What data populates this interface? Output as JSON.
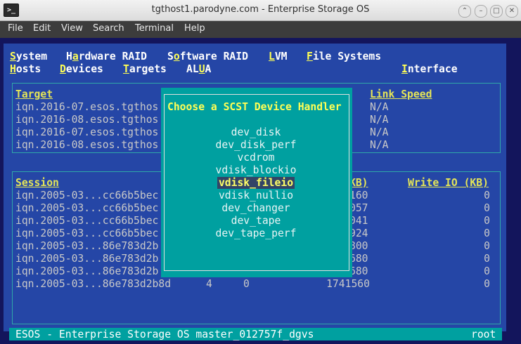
{
  "window": {
    "title": "tgthost1.parodyne.com - Enterprise Storage OS",
    "app_icon": ">_"
  },
  "menubar": {
    "items": [
      "File",
      "Edit",
      "View",
      "Search",
      "Terminal",
      "Help"
    ]
  },
  "tui_menu": {
    "row1": [
      {
        "hotkey": "S",
        "rest": "ystem"
      },
      {
        "pre": "H",
        "hotkey": "a",
        "rest": "rdware RAID"
      },
      {
        "pre": "S",
        "hotkey": "o",
        "rest": "ftware RAID"
      },
      {
        "hotkey": "L",
        "rest": "VM"
      },
      {
        "hotkey": "F",
        "rest": "ile Systems"
      }
    ],
    "row2": [
      {
        "hotkey": "H",
        "rest": "osts"
      },
      {
        "hotkey": "D",
        "rest": "evices"
      },
      {
        "hotkey": "T",
        "rest": "argets"
      },
      {
        "pre": "AL",
        "hotkey": "U",
        "rest": "A"
      },
      {
        "hotkey": "I",
        "rest": "nterface"
      }
    ]
  },
  "targets": {
    "headers": {
      "target": "Target",
      "link_speed": "Link Speed"
    },
    "rows": [
      {
        "target": "iqn.2016-07.esos.tgthos",
        "link": "N/A"
      },
      {
        "target": "iqn.2016-08.esos.tgthos",
        "link": "N/A"
      },
      {
        "target": "iqn.2016-07.esos.tgthos",
        "link": "N/A"
      },
      {
        "target": "iqn.2016-08.esos.tgthos",
        "link": "N/A"
      }
    ]
  },
  "sessions": {
    "headers": {
      "session": "Session",
      "read_partial": "KB)",
      "write": "Write IO (KB)"
    },
    "rows": [
      {
        "session": "iqn.2005-03...cc66b5bec",
        "read": "160",
        "write": "0"
      },
      {
        "session": "iqn.2005-03...cc66b5bec",
        "read": "057",
        "write": "0"
      },
      {
        "session": "iqn.2005-03...cc66b5bec",
        "read": "041",
        "write": "0"
      },
      {
        "session": "iqn.2005-03...cc66b5bec",
        "read": "924",
        "write": "0"
      },
      {
        "session": "iqn.2005-03...86e783d2b",
        "read": "800",
        "write": "0"
      },
      {
        "session": "iqn.2005-03...86e783d2b",
        "read": "680",
        "write": "0"
      },
      {
        "session": "iqn.2005-03...86e783d2b",
        "read": "680",
        "write": "0"
      }
    ],
    "last_row": {
      "session": "iqn.2005-03...86e783d2b8d",
      "col2": "4",
      "col3": "0",
      "read": "1741560",
      "write": "0"
    }
  },
  "dialog": {
    "title": "Choose a SCST Device Handler",
    "options": [
      "dev_disk",
      "dev_disk_perf",
      "vcdrom",
      "vdisk_blockio",
      "vdisk_fileio",
      "vdisk_nullio",
      "dev_changer",
      "dev_tape",
      "dev_tape_perf"
    ],
    "selected": "vdisk_fileio"
  },
  "status_bar": {
    "left": "ESOS - Enterprise Storage OS master_012757f_dgvs",
    "right": "root"
  },
  "colors": {
    "terminal_bg": "#2546a6",
    "dialog_bg": "#00a0a0",
    "highlight": "#ffff55"
  }
}
